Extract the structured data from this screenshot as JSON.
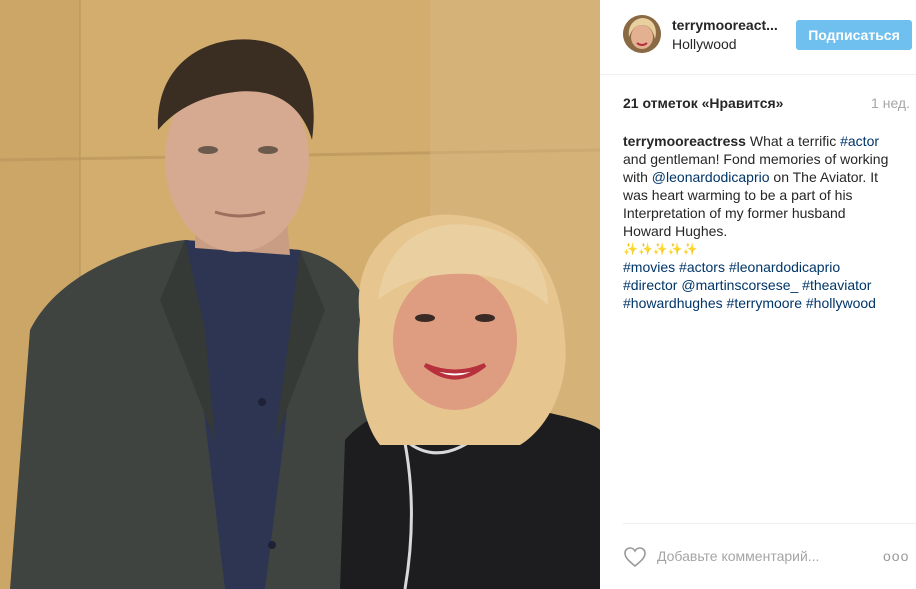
{
  "photo": {
    "description_icon": "photo-icon"
  },
  "header": {
    "username": "terrymooreact...",
    "location": "Hollywood",
    "follow_label": "Подписаться"
  },
  "meta": {
    "likes": "21 отметок «Нравится»",
    "time": "1 нед."
  },
  "caption": {
    "user": "terrymooreactress",
    "l1_text": " What a terrific ",
    "l1_tag": "#actor",
    "l2": "and gentleman! Fond memories of working",
    "l3_pre": "with ",
    "l3_mention": "@leonardodicaprio",
    "l3_post": " on The Aviator. It",
    "l4": "was heart warming to be a part of his",
    "l5": "Interpretation of my former husband",
    "l6": "Howard Hughes.",
    "l7": "✨✨✨✨✨",
    "tags1": [
      "#movies",
      "#actors",
      "#leonardodicaprio"
    ],
    "tags2": [
      "#director",
      "@martinscorsese_",
      "#theaviator"
    ],
    "tags3": [
      "#howardhughes",
      "#terrymoore",
      "#hollywood"
    ]
  },
  "comment": {
    "placeholder": "Добавьте комментарий...",
    "more_label": "ooo"
  },
  "colors": {
    "follow_button": "#70c0ef",
    "link": "#003569",
    "muted": "#a5a5a5"
  }
}
